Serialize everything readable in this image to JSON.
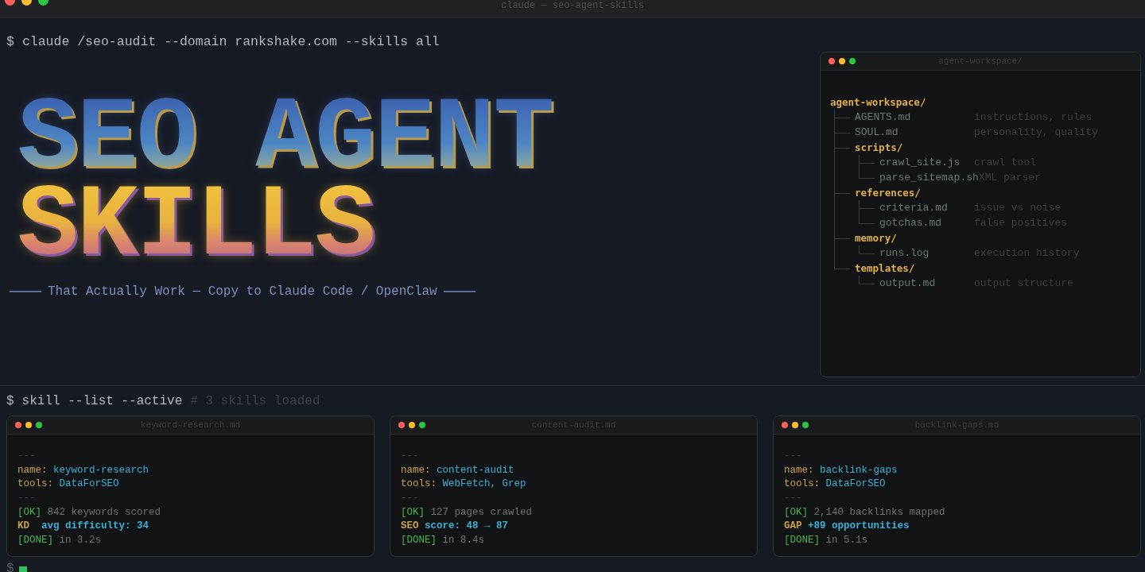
{
  "window": {
    "title": "claude — seo-agent-skills"
  },
  "command": {
    "prompt": "$",
    "text": "claude /seo-audit --domain rankshake.com --skills all"
  },
  "banner": {
    "lines": [
      "SEO AGENT",
      "SKILLS"
    ],
    "tagline": "That Actually Work — Copy to Claude Code / OpenClaw"
  },
  "workspace": {
    "title": "agent-workspace/",
    "tree": {
      "name": "agent-workspace/",
      "kind": "dir",
      "children": [
        {
          "name": "AGENTS.md",
          "kind": "file",
          "comment": "instructions, rules"
        },
        {
          "name": "SOUL.md",
          "kind": "file",
          "comment": "personality, quality"
        },
        {
          "name": "scripts/",
          "kind": "dir",
          "children": [
            {
              "name": "crawl_site.js",
              "kind": "file",
              "comment": "crawl tool"
            },
            {
              "name": "parse_sitemap.sh",
              "kind": "file",
              "comment": "XML parser"
            }
          ]
        },
        {
          "name": "references/",
          "kind": "dir",
          "children": [
            {
              "name": "criteria.md",
              "kind": "file",
              "comment": "issue vs noise"
            },
            {
              "name": "gotchas.md",
              "kind": "file",
              "comment": "false positives"
            }
          ]
        },
        {
          "name": "memory/",
          "kind": "dir",
          "children": [
            {
              "name": "runs.log",
              "kind": "file",
              "comment": "execution history"
            }
          ]
        },
        {
          "name": "templates/",
          "kind": "dir",
          "children": [
            {
              "name": "output.md",
              "kind": "file",
              "comment": "output structure"
            }
          ]
        }
      ]
    }
  },
  "skills_command": {
    "prompt": "$",
    "text": "skill --list --active",
    "comment": "# 3 skills loaded"
  },
  "cards": [
    {
      "title": "keyword-research.md",
      "lines": [
        {
          "kind": "rule",
          "text": "---"
        },
        {
          "kind": "field",
          "key": "name:",
          "value": "keyword-research"
        },
        {
          "kind": "field",
          "key": "tools:",
          "value": "DataForSEO"
        },
        {
          "kind": "rule",
          "text": "---"
        },
        {
          "kind": "status",
          "tag": "[OK]",
          "text": "842 keywords scored"
        },
        {
          "kind": "metric",
          "key": "KD ",
          "value": "avg difficulty: 34"
        },
        {
          "kind": "status",
          "tag": "[DONE]",
          "text": "in 3.2s"
        }
      ]
    },
    {
      "title": "content-audit.md",
      "lines": [
        {
          "kind": "rule",
          "text": "---"
        },
        {
          "kind": "field",
          "key": "name:",
          "value": "content-audit"
        },
        {
          "kind": "field",
          "key": "tools:",
          "value": "WebFetch, Grep"
        },
        {
          "kind": "rule",
          "text": "---"
        },
        {
          "kind": "status",
          "tag": "[OK]",
          "text": "127 pages crawled"
        },
        {
          "kind": "metric",
          "key": "SEO",
          "value": "score: 48 → 87"
        },
        {
          "kind": "status",
          "tag": "[DONE]",
          "text": "in 8.4s"
        }
      ]
    },
    {
      "title": "backlink-gaps.md",
      "lines": [
        {
          "kind": "rule",
          "text": "---"
        },
        {
          "kind": "field",
          "key": "name:",
          "value": "backlink-gaps"
        },
        {
          "kind": "field",
          "key": "tools:",
          "value": "DataForSEO"
        },
        {
          "kind": "rule",
          "text": "---"
        },
        {
          "kind": "status",
          "tag": "[OK]",
          "text": "2,140 backlinks mapped"
        },
        {
          "kind": "metric",
          "key": "GAP",
          "value": "+89 opportunities"
        },
        {
          "kind": "status",
          "tag": "[DONE]",
          "text": "in 5.1s"
        }
      ]
    }
  ],
  "final_prompt": {
    "prompt": "$"
  }
}
